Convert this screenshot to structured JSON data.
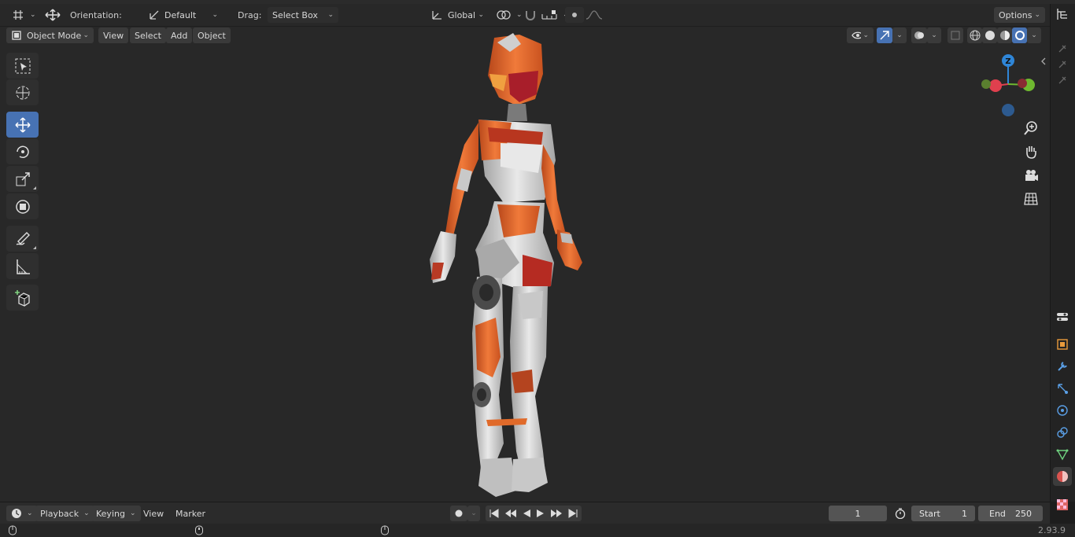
{
  "tool_header": {
    "orientation_label": "Orientation:",
    "orientation_value": "Default",
    "drag_label": "Drag:",
    "drag_value": "Select Box",
    "transform_orientation": "Global",
    "options_label": "Options"
  },
  "viewport_header": {
    "mode": "Object Mode",
    "menu": [
      "View",
      "Select",
      "Add",
      "Object"
    ]
  },
  "gizmo": {
    "z_label": "Z"
  },
  "timeline": {
    "menu": [
      "Playback",
      "Keying",
      "View",
      "Marker"
    ],
    "current_frame": "1",
    "start_label": "Start",
    "start_value": "1",
    "end_label": "End",
    "end_value": "250"
  },
  "status": {
    "version": "2.93.9"
  },
  "colors": {
    "accent": "#4772b3",
    "axis_x": "#e0404e",
    "axis_y": "#6fb830",
    "axis_z": "#2f86d8",
    "character_orange": "#e0652a"
  },
  "icons": {
    "toolbar": [
      "select-box-icon",
      "cursor-icon",
      "move-icon",
      "rotate-icon",
      "scale-icon",
      "transform-icon",
      "annotate-icon",
      "measure-icon",
      "add-cube-icon"
    ],
    "navigation": [
      "zoom-icon",
      "hand-icon",
      "camera-icon",
      "grid-icon"
    ],
    "properties": [
      "tool-icon",
      "object-icon",
      "modifier-icon",
      "particles-icon",
      "physics-icon",
      "constraints-icon",
      "data-icon",
      "material-icon",
      "texture-icon"
    ]
  }
}
